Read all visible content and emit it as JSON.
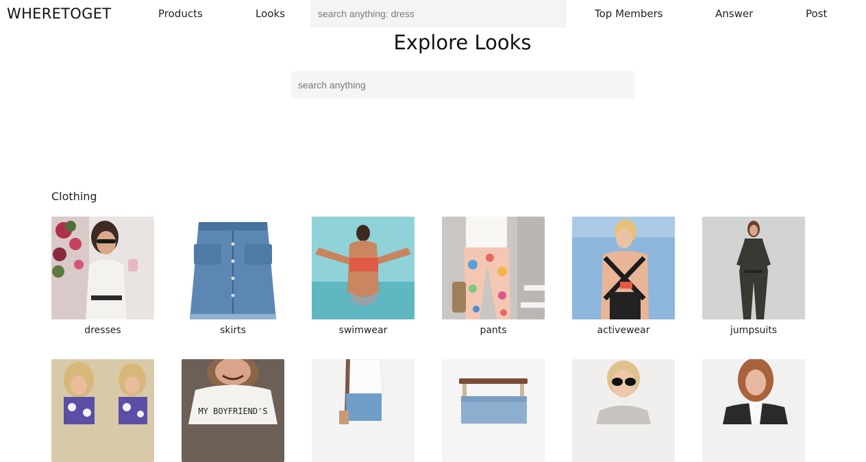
{
  "header": {
    "logo": "WHERETOGET",
    "nav_left": [
      "Products",
      "Looks"
    ],
    "search_placeholder": "search anything: dress",
    "nav_right": [
      "Top Members",
      "Answer",
      "Post"
    ]
  },
  "hero": {
    "title": "Explore Looks",
    "search_placeholder": "search anything"
  },
  "section": {
    "title": "Clothing",
    "categories": [
      {
        "label": "dresses",
        "image": "woman-white-dress-photo"
      },
      {
        "label": "skirts",
        "image": "denim-skirt-photo"
      },
      {
        "label": "swimwear",
        "image": "swimwear-beach-photo"
      },
      {
        "label": "pants",
        "image": "floral-pants-photo"
      },
      {
        "label": "activewear",
        "image": "activewear-photo"
      },
      {
        "label": "jumpsuits",
        "image": "jumpsuit-photo"
      },
      {
        "label": "",
        "image": "floral-top-photo"
      },
      {
        "label": "",
        "image": "boyfriend-tee-photo"
      },
      {
        "label": "",
        "image": "white-tee-jeans-photo"
      },
      {
        "label": "",
        "image": "jeans-on-hanger-photo"
      },
      {
        "label": "",
        "image": "sunglasses-woman-photo"
      },
      {
        "label": "",
        "image": "jacket-woman-photo"
      }
    ],
    "row2_visible_text": "MY BOYFRIEND'S"
  }
}
